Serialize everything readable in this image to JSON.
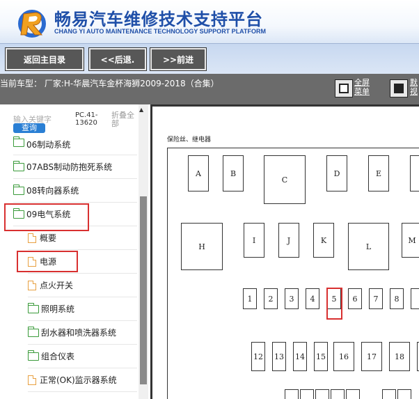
{
  "header": {
    "brand_cn": "畅易汽车维修技术支持平台",
    "brand_en": "CHANG YI AUTO MAINTENANCE TECHNOLOGY SUPPORT PLATFORM"
  },
  "toolbar": {
    "home_label": "返回主目录",
    "back_label": "<<后退.",
    "forward_label": ">>前进"
  },
  "model_bar": {
    "text": "当前车型： 厂家:H-华晨汽车金杯海狮2009-2018（合集）",
    "fullscreen_label_1": "全屏",
    "fullscreen_label_2": "菜单",
    "default_label_1": "默",
    "default_label_2": "视"
  },
  "sidebar": {
    "search_placeholder": "输入关键字",
    "search_button": "查询",
    "pc_code_1": "PC.41-",
    "pc_code_2": "13620",
    "collapse_1": "折叠全",
    "collapse_2": "部",
    "items": [
      {
        "label": "06制动系统",
        "icon": "folder-icon"
      },
      {
        "label": "07ABS制动防抱死系统",
        "icon": "folder-icon"
      },
      {
        "label": "08转向器系统",
        "icon": "folder-icon"
      },
      {
        "label": "09电气系统",
        "icon": "folder-open-icon"
      },
      {
        "label": "概要",
        "icon": "document-icon"
      },
      {
        "label": "电源",
        "icon": "document-icon"
      },
      {
        "label": "点火开关",
        "icon": "document-icon"
      },
      {
        "label": "照明系统",
        "icon": "folder-icon"
      },
      {
        "label": "刮水器和喷洗器系统",
        "icon": "folder-icon"
      },
      {
        "label": "组合仪表",
        "icon": "folder-icon"
      },
      {
        "label": "正常(OK)监示器系统",
        "icon": "document-icon"
      }
    ]
  },
  "diagram": {
    "title": "保险丝、继电器",
    "relays_row1": [
      "A",
      "B",
      "C",
      "D",
      "E"
    ],
    "relays_row2": [
      "H",
      "I",
      "J",
      "K",
      "L",
      "M"
    ],
    "fuses_row1": [
      "1",
      "2",
      "3",
      "4",
      "5",
      "6",
      "7",
      "8"
    ],
    "fuses_row2": [
      "12",
      "13",
      "14",
      "15",
      "16",
      "17",
      "18"
    ],
    "highlight_color": "#d83030"
  }
}
